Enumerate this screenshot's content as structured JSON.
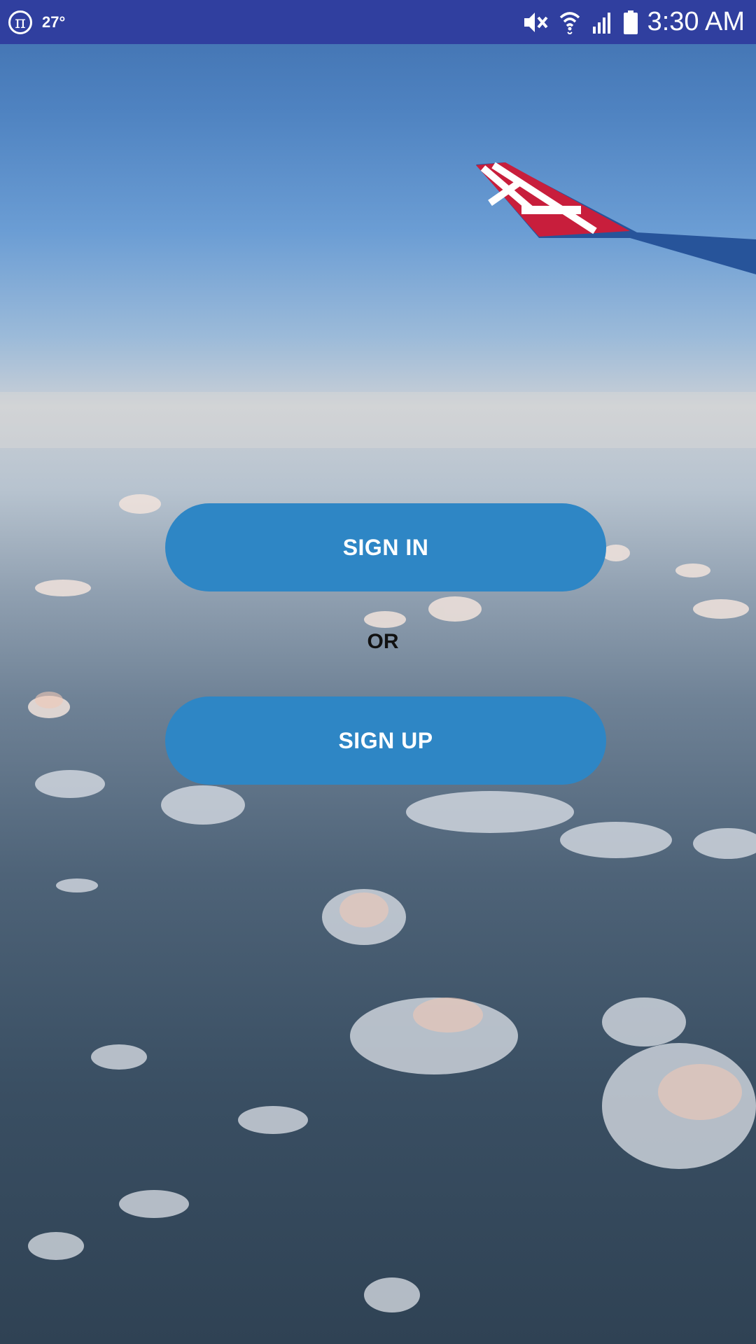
{
  "status_bar": {
    "temperature": "27°",
    "time": "3:30 AM",
    "icons": [
      "pi-icon",
      "mute-icon",
      "wifi-icon",
      "signal-icon",
      "battery-icon"
    ],
    "background_color": "#303f9f"
  },
  "main": {
    "sign_in_label": "SIGN IN",
    "or_label": "OR",
    "sign_up_label": "SIGN UP",
    "button_color": "#2e86c5"
  }
}
